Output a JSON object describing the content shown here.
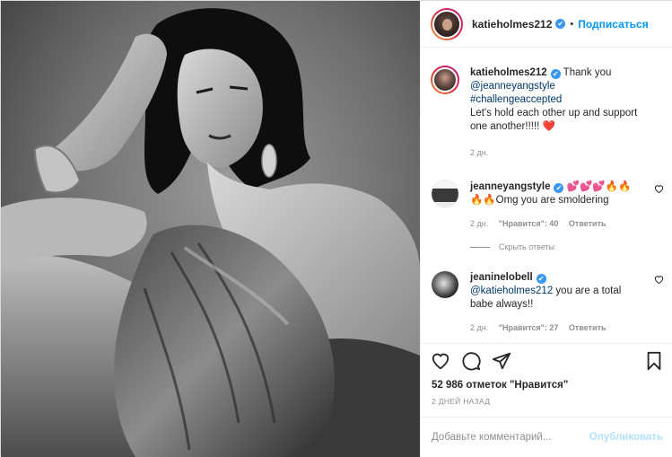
{
  "header": {
    "username": "katieholmes212",
    "separator": "•",
    "follow_label": "Подписаться",
    "verified_mark": "✔"
  },
  "caption": {
    "username": "katieholmes212",
    "text_start": "Thank you",
    "mention": "@jeanneyangstyle",
    "hashtag": "#challengeaccepted",
    "text_end": "Let's hold each other up and support one another!!!!!",
    "emoji": "❤️",
    "time": "2 дн."
  },
  "comments": [
    {
      "username": "jeanneyangstyle",
      "emojis": "💕💕💕🔥🔥",
      "emojis2": "🔥🔥",
      "text": "Omg you are smoldering",
      "time": "2 дн.",
      "likes": "\"Нравится\": 40",
      "reply": "Ответить"
    },
    {
      "username": "jeaninelobell",
      "mention": "@katieholmes212",
      "text": " you are a total babe always!!",
      "time": "2 дн.",
      "likes": "\"Нравится\": 27",
      "reply": "Ответить"
    }
  ],
  "hide_replies": "Скрыть ответы",
  "likes_count": "52 986 отметок \"Нравится\"",
  "posted_ago": "2 ДНЕЙ НАЗАД",
  "comment_input": {
    "placeholder": "Добавьте комментарий...",
    "value": ""
  },
  "publish_label": "Опубликовать",
  "icons": {
    "like": "heart-icon",
    "comment": "comment-icon",
    "share": "share-icon",
    "save": "bookmark-icon",
    "comment_like": "heart-icon"
  }
}
